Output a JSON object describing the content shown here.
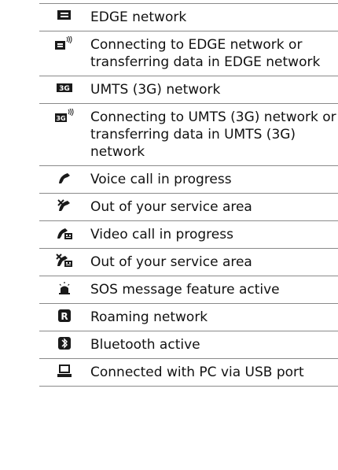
{
  "rows": [
    {
      "icon": "edge-icon",
      "text": "EDGE network"
    },
    {
      "icon": "edge-transfer-icon",
      "text": "Connecting to EDGE network or transferring data in EDGE network"
    },
    {
      "icon": "umts-icon",
      "text": "UMTS (3G) network"
    },
    {
      "icon": "umts-transfer-icon",
      "text": "Connecting to UMTS (3G) network or transferring data in UMTS (3G) network"
    },
    {
      "icon": "voice-call-icon",
      "text": "Voice call in progress"
    },
    {
      "icon": "voice-call-out-of-service-icon",
      "text": "Out of your service area"
    },
    {
      "icon": "video-call-icon",
      "text": "Video call in progress"
    },
    {
      "icon": "video-call-out-of-service-icon",
      "text": "Out of your service area"
    },
    {
      "icon": "sos-icon",
      "text": "SOS message feature active"
    },
    {
      "icon": "roaming-icon",
      "text": "Roaming network"
    },
    {
      "icon": "bluetooth-icon",
      "text": "Bluetooth active"
    },
    {
      "icon": "pc-usb-icon",
      "text": "Connected with PC via USB port"
    }
  ]
}
